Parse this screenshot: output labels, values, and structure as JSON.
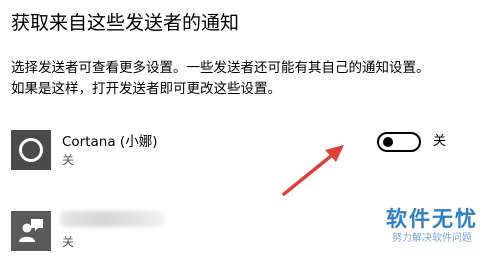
{
  "section": {
    "title": "获取来自这些发送者的通知",
    "description": "选择发送者可查看更多设置。一些发送者还可能有其自己的通知设置。如果是这样，打开发送者即可更改这些设置。"
  },
  "senders": [
    {
      "name": "Cortana (小娜)",
      "state": "关",
      "icon": "cortana-ring-icon",
      "toggle": {
        "on": false,
        "label": "关"
      }
    },
    {
      "name": "",
      "state": "关",
      "icon": "contact-support-icon"
    }
  ],
  "annotation": {
    "arrow_color": "#e0403a"
  },
  "watermark": {
    "title": "软件无忧",
    "subtitle": "努力解决软件问题",
    "color": "#2d7fc6"
  }
}
